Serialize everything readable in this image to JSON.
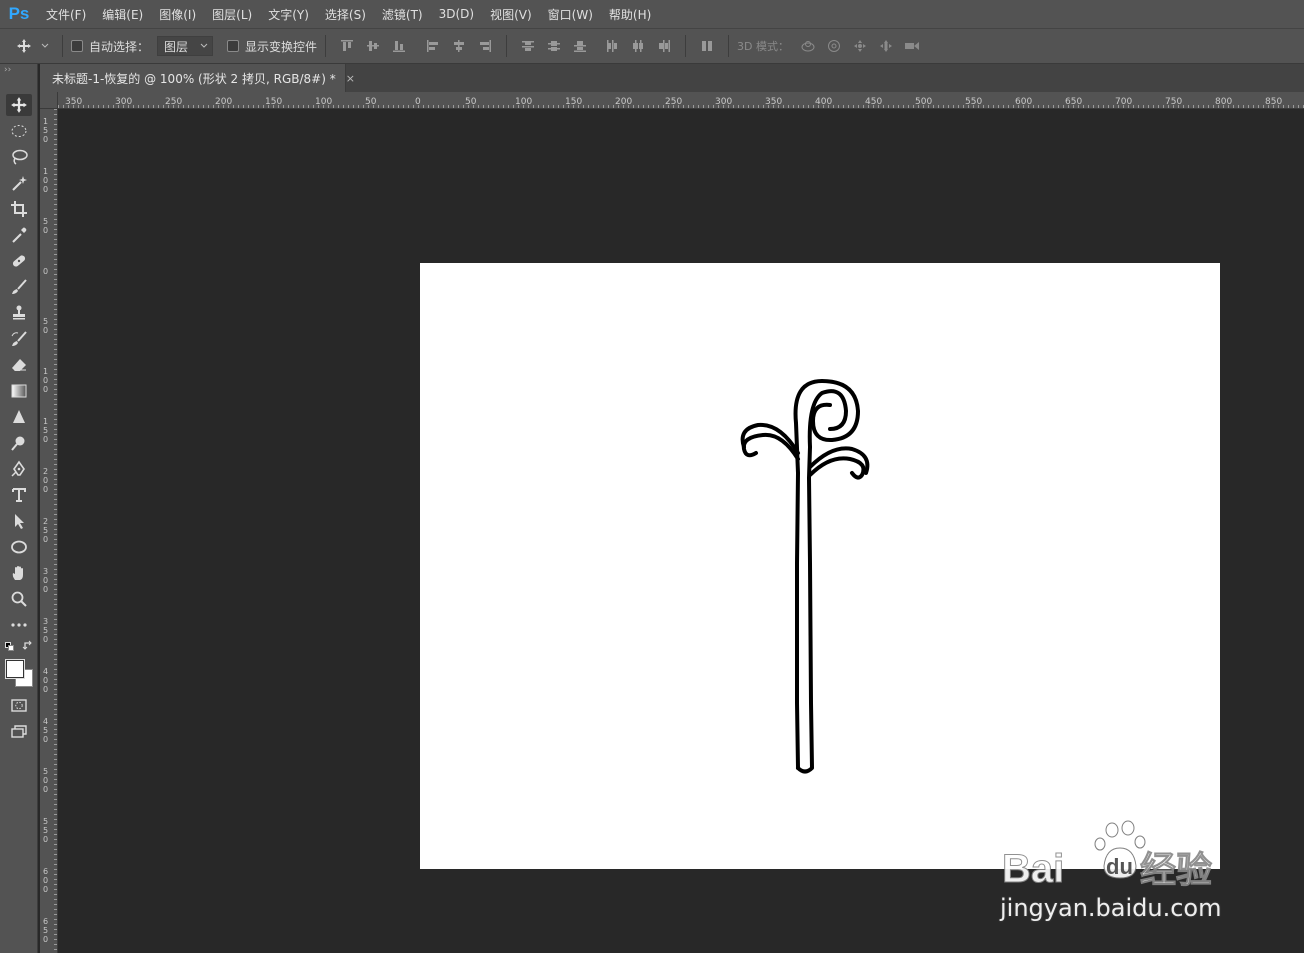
{
  "app": {
    "logo": "Ps"
  },
  "menu": [
    "文件(F)",
    "编辑(E)",
    "图像(I)",
    "图层(L)",
    "文字(Y)",
    "选择(S)",
    "滤镜(T)",
    "3D(D)",
    "视图(V)",
    "窗口(W)",
    "帮助(H)"
  ],
  "options": {
    "auto_select_label": "自动选择：",
    "auto_select_value": "图层",
    "show_transform_label": "显示变换控件",
    "mode_3d_label": "3D 模式："
  },
  "document": {
    "tab_title": "未标题-1-恢复的 @ 100% (形状 2 拷贝, RGB/8#) *",
    "close_glyph": "×"
  },
  "rulers": {
    "horizontal": [
      "350",
      "300",
      "250",
      "200",
      "150",
      "100",
      "50",
      "0",
      "50",
      "100",
      "150",
      "200",
      "250",
      "300",
      "350",
      "400",
      "450",
      "500",
      "550",
      "600",
      "650",
      "700",
      "750",
      "800",
      "850"
    ],
    "vertical": [
      "150",
      "100",
      "50",
      "0",
      "50",
      "100",
      "150",
      "200",
      "250",
      "300",
      "350",
      "400",
      "450",
      "500",
      "550",
      "600",
      "650"
    ]
  },
  "tools": [
    "move-icon",
    "marquee-icon",
    "lasso-icon",
    "magic-wand-icon",
    "crop-icon",
    "eyedropper-icon",
    "healing-brush-icon",
    "brush-icon",
    "clone-stamp-icon",
    "history-brush-icon",
    "eraser-icon",
    "gradient-icon",
    "blur-icon",
    "dodge-icon",
    "pen-icon",
    "type-icon",
    "path-select-icon",
    "shape-icon",
    "hand-icon",
    "zoom-icon",
    "more-tools-icon"
  ],
  "colors": {
    "foreground": "#ffffff",
    "background": "#ffffff",
    "accent": "#31a8ff"
  },
  "watermark": {
    "url": "jingyan.baidu.com"
  }
}
